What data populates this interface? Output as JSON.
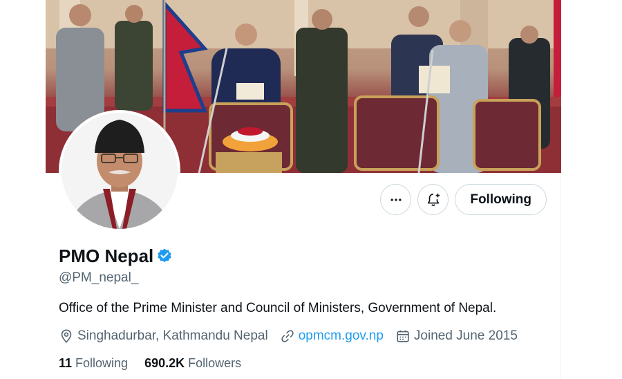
{
  "profile": {
    "name": "PMO Nepal",
    "handle": "@PM_nepal_",
    "bio": "Office of the Prime Minister and Council of Ministers, Government of Nepal.",
    "location": "Singhadurbar, Kathmandu Nepal",
    "website": "opmcm.gov.np",
    "joined": "Joined June 2015",
    "verified": true
  },
  "actions": {
    "more_icon": "more-horizontal-icon",
    "notify_icon": "bell-plus-icon",
    "follow_label": "Following"
  },
  "stats": {
    "following_count": "11",
    "following_label": "Following",
    "followers_count": "690.2K",
    "followers_label": "Followers"
  },
  "colors": {
    "accent": "#1d9bf0",
    "text": "#0f1419",
    "secondary": "#536471",
    "border": "#cfd9de"
  }
}
